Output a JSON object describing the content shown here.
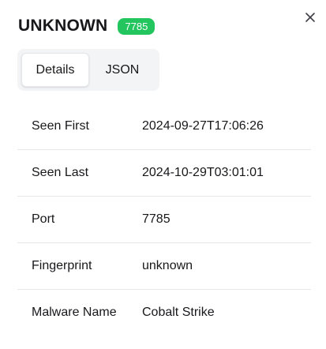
{
  "header": {
    "title": "UNKNOWN",
    "badge": "7785",
    "badge_color": "#22c55e"
  },
  "close_icon": "close-icon",
  "tabs": [
    {
      "label": "Details",
      "active": true
    },
    {
      "label": "JSON",
      "active": false
    }
  ],
  "details": [
    {
      "key": "Seen First",
      "value": "2024-09-27T17:06:26"
    },
    {
      "key": "Seen Last",
      "value": "2024-10-29T03:01:01"
    },
    {
      "key": "Port",
      "value": "7785"
    },
    {
      "key": "Fingerprint",
      "value": "unknown"
    },
    {
      "key": "Malware Name",
      "value": "Cobalt Strike"
    }
  ]
}
